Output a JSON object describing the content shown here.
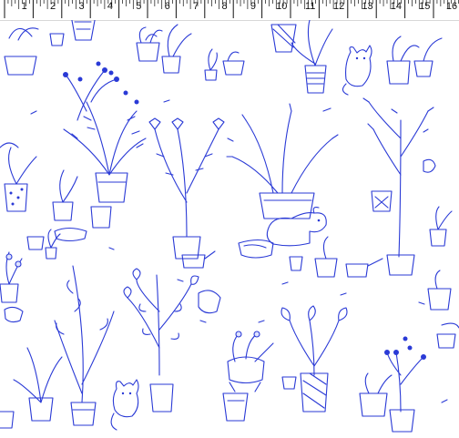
{
  "ruler": {
    "unit": "inch",
    "labels": [
      "1",
      "2",
      "3",
      "4",
      "5",
      "6",
      "7",
      "8",
      "9",
      "10",
      "11",
      "12",
      "13",
      "14",
      "15",
      "16"
    ]
  },
  "fabric": {
    "ink_color": "#2a3ad6",
    "background_color": "#ffffff",
    "motifs": [
      "potted-plant",
      "cat",
      "dog",
      "watering-can",
      "fern",
      "flower-pot",
      "leaf",
      "berry-branch"
    ]
  }
}
